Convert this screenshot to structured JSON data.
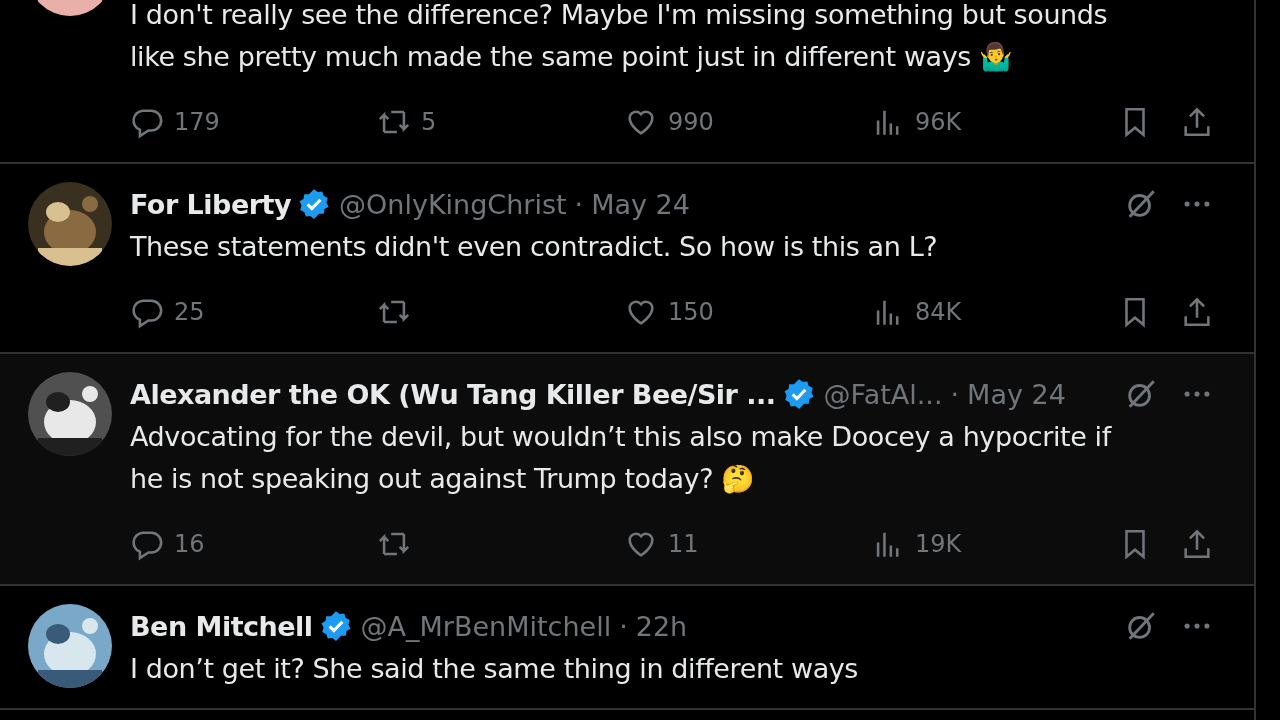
{
  "posts": [
    {
      "hovered": false,
      "body_lines": [
        "I don't really see the difference? Maybe I'm missing something but sounds",
        "like she pretty much made the same point just in different ways 🤷‍♂️"
      ],
      "replies": "179",
      "reposts": "5",
      "likes": "990",
      "views": "96K"
    },
    {
      "hovered": false,
      "name": "For Liberty",
      "verified": true,
      "handle": "@OnlyKingChrist",
      "separator": "·",
      "date": "May 24",
      "body_lines": [
        "These statements didn't even contradict. So how is this an L?"
      ],
      "replies": "25",
      "likes": "150",
      "views": "84K"
    },
    {
      "hovered": true,
      "name": "Alexander the OK (Wu Tang Killer Bee/Sir ...",
      "verified": true,
      "handle": "@FatAl...",
      "separator": "·",
      "date": "May 24",
      "body_lines": [
        "Advocating for the devil, but wouldn’t this also make Doocey a hypocrite if",
        "he is not speaking out against Trump today? 🤔"
      ],
      "replies": "16",
      "likes": "11",
      "views": "19K"
    },
    {
      "hovered": false,
      "name": "Ben Mitchell",
      "verified": true,
      "handle": "@A_MrBenMitchell",
      "separator": "·",
      "date": "22h",
      "body_lines": [
        "I don’t get it? She said the same thing in different ways"
      ]
    }
  ]
}
